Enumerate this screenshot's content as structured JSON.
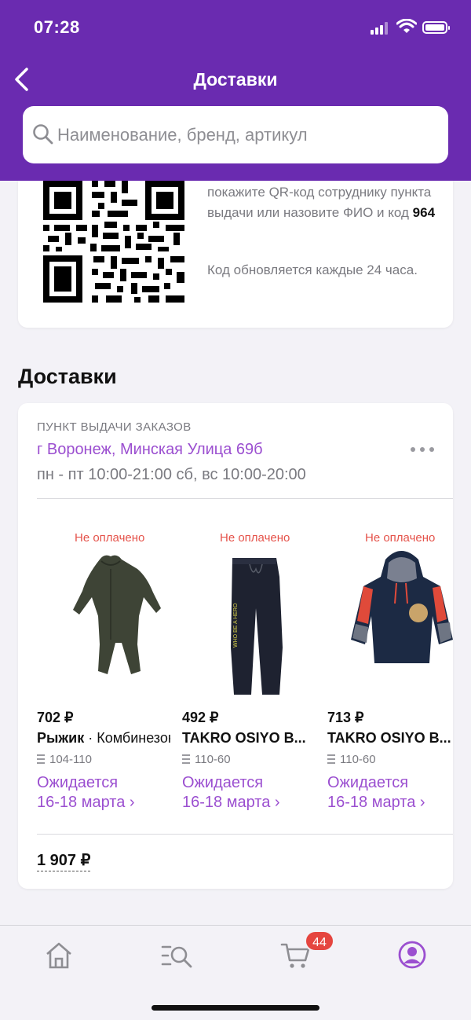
{
  "status_bar": {
    "time": "07:28"
  },
  "header": {
    "title": "Доставки"
  },
  "search": {
    "placeholder": "Наименование, бренд, артикул"
  },
  "qr_card": {
    "instruction_part": "покажите QR-код сотруднику пункта выдачи или назовите ФИО и код",
    "code": "964",
    "note": "Код обновляется каждые 24 часа."
  },
  "section_title": "Доставки",
  "delivery": {
    "pickup_label": "ПУНКТ ВЫДАЧИ ЗАКАЗОВ",
    "address": "г Воронеж, Минская Улица 69б",
    "hours": "пн - пт 10:00-21:00 сб, вс 10:00-20:00",
    "products": [
      {
        "status": "Не оплачено",
        "price": "702 ₽",
        "brand": "Рыжик",
        "name": " · Комбинезон",
        "size": "104-110",
        "expected_line1": "Ожидается",
        "expected_line2": "16-18 марта ›"
      },
      {
        "status": "Не оплачено",
        "price": "492 ₽",
        "brand": "TAKRO OSIYO B...",
        "name": "",
        "size": "110-60",
        "expected_line1": "Ожидается",
        "expected_line2": "16-18 марта ›"
      },
      {
        "status": "Не оплачено",
        "price": "713 ₽",
        "brand": "TAKRO OSIYO B...",
        "name": "",
        "size": "110-60",
        "expected_line1": "Ожидается",
        "expected_line2": "16-18 марта ›"
      }
    ],
    "total": "1 907 ₽"
  },
  "tabbar": {
    "items": [
      "home-icon",
      "catalog-search-icon",
      "cart-icon",
      "profile-icon"
    ],
    "cart_badge": "44"
  },
  "colors": {
    "brand": "#6a2bb0",
    "accent": "#9b4fd0",
    "unpaid": "#e5534b",
    "badge": "#e5453f"
  }
}
